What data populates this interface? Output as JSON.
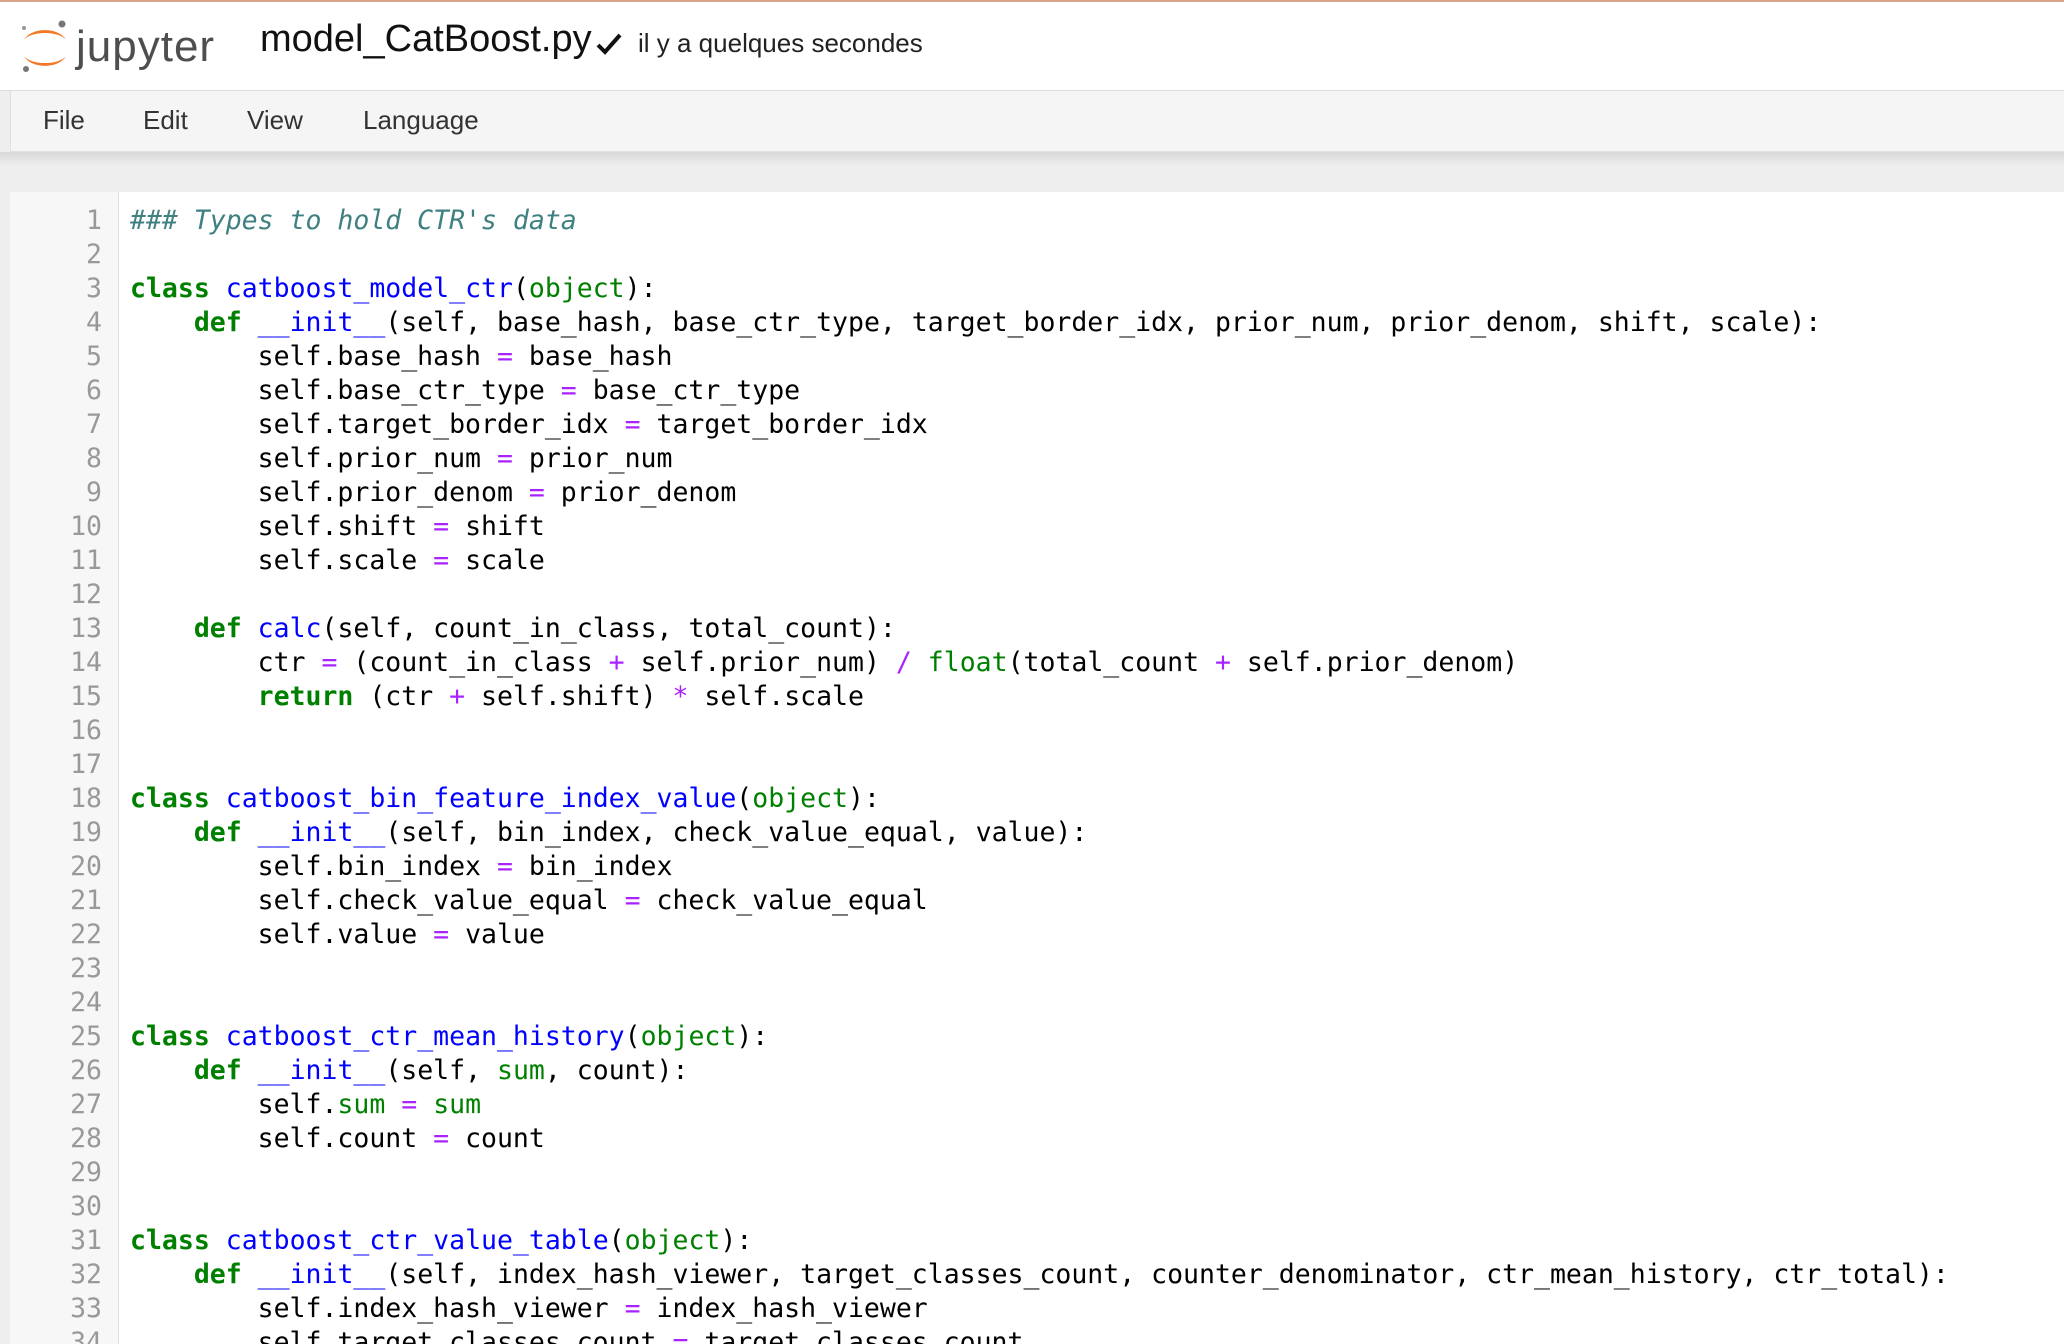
{
  "header": {
    "logo_text": "jupyter",
    "filename": "model_CatBoost.py",
    "save_status": "il y a quelques secondes"
  },
  "menu": [
    "File",
    "Edit",
    "View",
    "Language"
  ],
  "colors": {
    "keyword": "#008000",
    "definition": "#0000ff",
    "builtin": "#008000",
    "operator": "#aa22ff",
    "comment": "#408080",
    "logo_orange": "#f37726"
  },
  "editor": {
    "lines": [
      "### Types to hold CTR's data",
      "",
      "class catboost_model_ctr(object):",
      "    def __init__(self, base_hash, base_ctr_type, target_border_idx, prior_num, prior_denom, shift, scale):",
      "        self.base_hash = base_hash",
      "        self.base_ctr_type = base_ctr_type",
      "        self.target_border_idx = target_border_idx",
      "        self.prior_num = prior_num",
      "        self.prior_denom = prior_denom",
      "        self.shift = shift",
      "        self.scale = scale",
      "",
      "    def calc(self, count_in_class, total_count):",
      "        ctr = (count_in_class + self.prior_num) / float(total_count + self.prior_denom)",
      "        return (ctr + self.shift) * self.scale",
      "",
      "",
      "class catboost_bin_feature_index_value(object):",
      "    def __init__(self, bin_index, check_value_equal, value):",
      "        self.bin_index = bin_index",
      "        self.check_value_equal = check_value_equal",
      "        self.value = value",
      "",
      "",
      "class catboost_ctr_mean_history(object):",
      "    def __init__(self, sum, count):",
      "        self.sum = sum",
      "        self.count = count",
      "",
      "",
      "class catboost_ctr_value_table(object):",
      "    def __init__(self, index_hash_viewer, target_classes_count, counter_denominator, ctr_mean_history, ctr_total):",
      "        self.index_hash_viewer = index_hash_viewer",
      "        self.target_classes_count = target_classes_count"
    ]
  }
}
